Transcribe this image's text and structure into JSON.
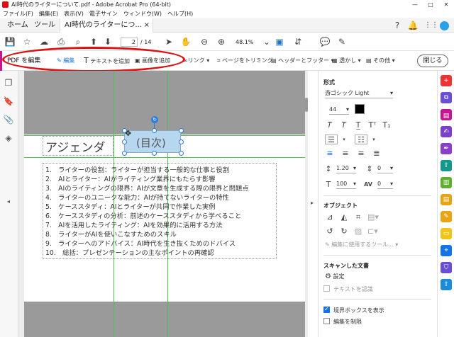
{
  "window": {
    "title": "AI時代のライターについて.pdf - Adobe Acrobat Pro (64-bit)",
    "minimize": "—",
    "maximize": "□",
    "close": "✕"
  },
  "menu": [
    "ファイル(F)",
    "編集(E)",
    "表示(V)",
    "電子サイン",
    "ウィンドウ(W)",
    "ヘルプ(H)"
  ],
  "tabs": {
    "home": "ホーム",
    "tools": "ツール",
    "doc": "AI時代のライターにつ...",
    "doc_close": "×"
  },
  "toolbar": {
    "page_current": "2",
    "page_total": "/ 14",
    "zoom": "48.1%"
  },
  "editbar": {
    "mode": "PDF を編集",
    "edit": "編集",
    "add_text": "テキストを追加",
    "add_image": "画像を追加",
    "link": "リンク",
    "crop": "ページをトリミング",
    "header_footer": "ヘッダーとフッター",
    "watermark": "透かし",
    "more": "その他",
    "close": "閉じる"
  },
  "document": {
    "heading": "アジェンダ",
    "toc": "(目次)",
    "items": [
      "1.　ライターの役割：ライターが担当する一般的な仕事と役割",
      "2.　AIとライター：AIがライティング業界にもたらす影響",
      "3.　AIのライティングの限界：AIが文章を生成する際の限界と問題点",
      "4.　ライターのユニークな能力：AIが持てないライターの特性",
      "5.　ケーススタディ：AIとライターが共同で作業した実例",
      "6.　ケーススタディの分析：前述のケーススタディから学べること",
      "7.　AIを活用したライティング：AIを効果的に活用する方法",
      "8.　ライターがAIを使いこなすためのスキル",
      "9.　ライターへのアドバイス：AI時代を生き抜くためのドバイス",
      "10.　総括：プレゼンテーションの主なポイントの再確認"
    ]
  },
  "panel": {
    "format_title": "形式",
    "font": "游ゴシック Light",
    "size": "44",
    "line_spacing": "1.20",
    "para_spacing": "0",
    "scale": "100",
    "tracking": "0",
    "char_spacing": "0",
    "objects_title": "オブジェクト",
    "edit_using": "編集に使用するツール...",
    "scanned_title": "スキャンした文書",
    "settings": "設定",
    "recognize": "テキストを認識",
    "show_bbox": "境界ボックスを表示",
    "restrict_edit": "編集を制限"
  },
  "colors": {
    "accent": "#1473e6",
    "oval": "#d11111",
    "guide": "#4fc04f",
    "text_fill": "#000000"
  }
}
